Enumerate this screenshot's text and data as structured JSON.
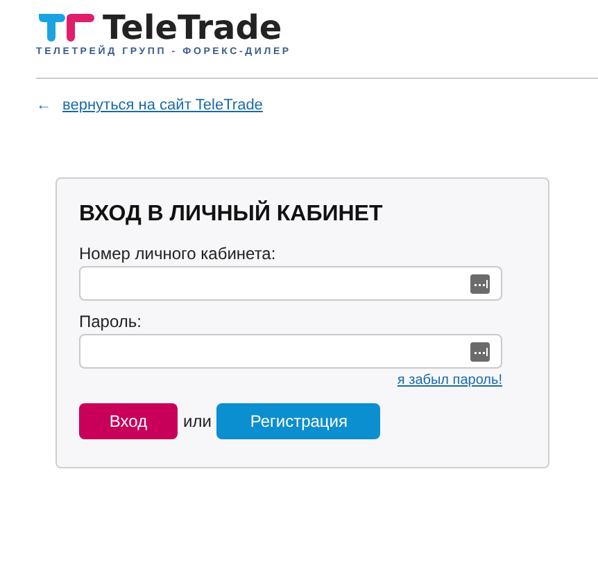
{
  "logo": {
    "name": "TeleTrade",
    "tagline": "ТЕЛЕТРЕЙД ГРУПП - ФОРЕКС-ДИЛЕР"
  },
  "back_link": {
    "arrow": "←",
    "label": "вернуться на сайт TeleTrade"
  },
  "login_form": {
    "title": "ВХОД В ЛИЧНЫЙ КАБИНЕТ",
    "fields": [
      {
        "label": "Номер личного кабинета:"
      },
      {
        "label": "Пароль:"
      }
    ],
    "forgot_link": "я забыл пароль!",
    "buttons": [
      {
        "label": "Вход",
        "kind": "primary"
      },
      {
        "label": "Регистрация",
        "kind": "secondary"
      }
    ],
    "separator": "или"
  }
}
